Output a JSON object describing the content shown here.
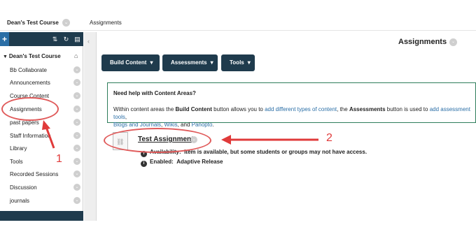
{
  "breadcrumb": {
    "course": "Dean's Test Course",
    "page": "Assignments"
  },
  "sidebar": {
    "course_title": "Dean's Test Course",
    "items": [
      {
        "label": "Bb Collaborate"
      },
      {
        "label": "Announcements"
      },
      {
        "label": "Course Content"
      },
      {
        "label": "Assignments"
      },
      {
        "label": "past papers"
      },
      {
        "label": "Staff Information"
      },
      {
        "label": "Library"
      },
      {
        "label": "Tools"
      },
      {
        "label": "Recorded Sessions"
      },
      {
        "label": "Discussion"
      },
      {
        "label": "journals"
      }
    ]
  },
  "main": {
    "title": "Assignments",
    "buttons": {
      "build": "Build Content",
      "assessments": "Assessments",
      "tools": "Tools"
    },
    "help": {
      "title": "Need help with Content Areas?",
      "t1": "Within content areas the ",
      "b1": "Build Content",
      "t2": " button allows you to ",
      "l1": "add different types of content",
      "t3": ", the ",
      "b2": "Assessments",
      "t4": " button is used to ",
      "l2": "add assessment tools",
      "t5": ",",
      "l3": "Blogs and Journals",
      "t6": ", ",
      "l4": "Wikis",
      "t7": ", and ",
      "l5": "Panopto",
      "t8": "."
    },
    "assignment": {
      "title": "Test Assignment",
      "availability_label": "Availability:",
      "availability_value": "Item is available, but some students or groups may not have access.",
      "enabled_label": "Enabled:",
      "enabled_value": "Adaptive Release"
    }
  },
  "annotations": {
    "one": "1",
    "two": "2"
  },
  "colors": {
    "nav_dark": "#1f3b4d",
    "accent_blue": "#2a6ea6",
    "annotation_red": "#e03a3a"
  }
}
